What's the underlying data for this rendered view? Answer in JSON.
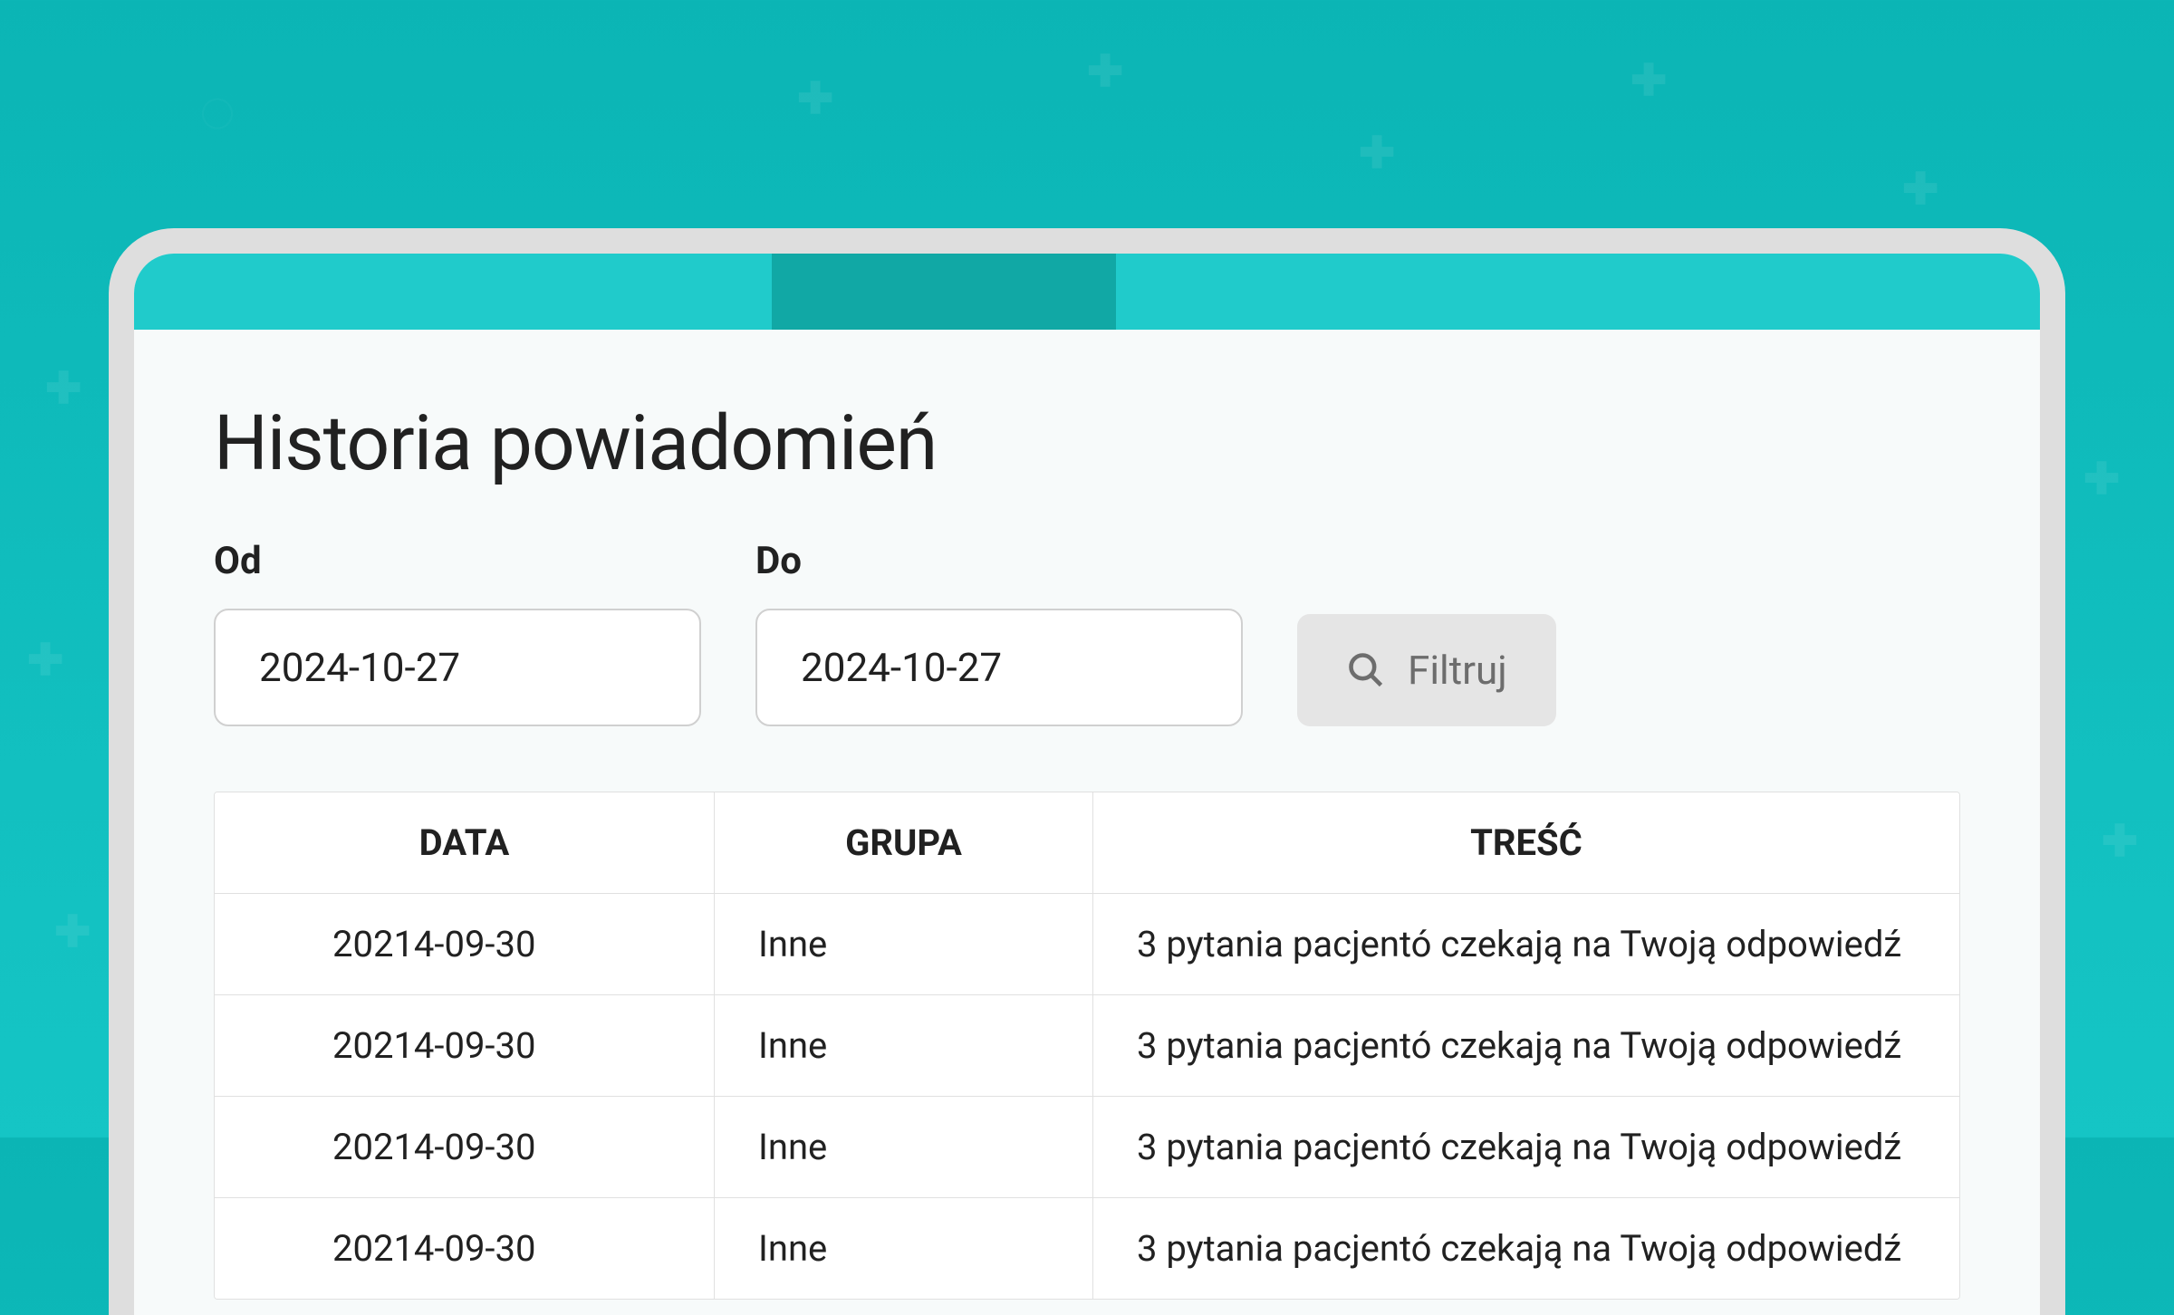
{
  "page": {
    "title": "Historia powiadomień"
  },
  "filters": {
    "from_label": "Od",
    "from_value": "2024-10-27",
    "to_label": "Do",
    "to_value": "2024-10-27",
    "button_label": "Filtruj"
  },
  "table": {
    "headers": {
      "date": "DATA",
      "group": "GRUPA",
      "content": "TREŚĆ"
    },
    "rows": [
      {
        "date": "20214-09-30",
        "group": "Inne",
        "content": "3 pytania pacjentó czekają na Twoją odpowiedź"
      },
      {
        "date": "20214-09-30",
        "group": "Inne",
        "content": "3 pytania pacjentó czekają na Twoją odpowiedź"
      },
      {
        "date": "20214-09-30",
        "group": "Inne",
        "content": "3 pytania pacjentó czekają na Twoją odpowiedź"
      },
      {
        "date": "20214-09-30",
        "group": "Inne",
        "content": "3 pytania pacjentó czekają na Twoją odpowiedź"
      }
    ]
  },
  "colors": {
    "teal_light": "#20cbcb",
    "teal_dark": "#11a8a5",
    "bg_gradient_start": "#0bb5b5",
    "bg_gradient_end": "#15c5c5"
  }
}
